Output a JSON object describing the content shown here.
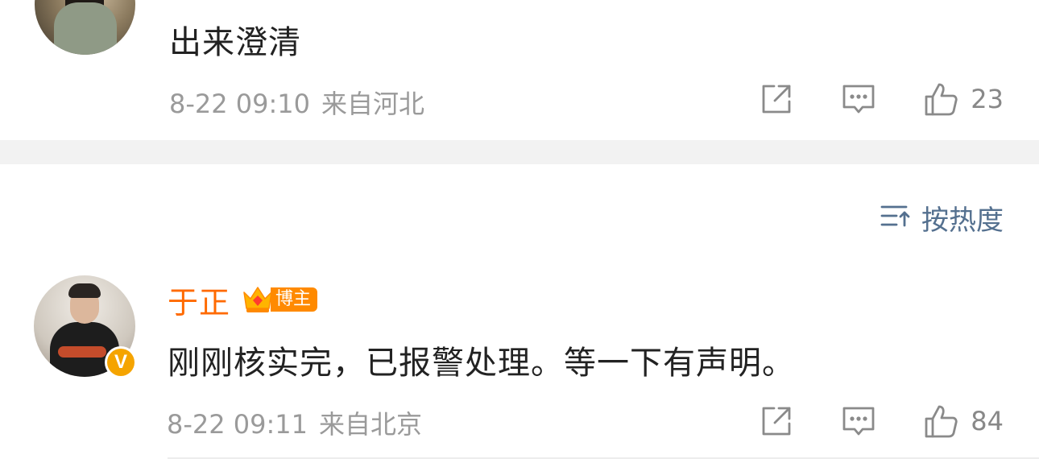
{
  "comments": [
    {
      "text": "出来澄清",
      "time": "8-22 09:10",
      "location": "来自河北",
      "likes": "23",
      "icons": {
        "repost": "repost-icon",
        "reply": "comment-icon",
        "like": "thumbs-up-icon"
      }
    },
    {
      "author": "于正",
      "badge": "博主",
      "verified": "V",
      "text": "刚刚核实完，已报警处理。等一下有声明。",
      "time": "8-22 09:11",
      "location": "来自北京",
      "likes": "84",
      "icons": {
        "repost": "repost-icon",
        "reply": "comment-icon",
        "like": "thumbs-up-icon"
      }
    }
  ],
  "sort": {
    "label": "按热度",
    "icon": "sort-icon"
  },
  "colors": {
    "author": "#ff6a00",
    "badge": "#ff8a00",
    "sort": "#54708f",
    "meta": "#9a9a9a",
    "verified": "#f5a400"
  }
}
